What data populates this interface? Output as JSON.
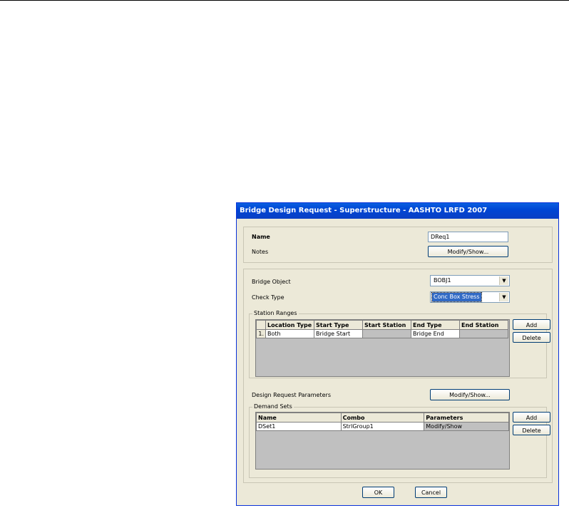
{
  "dialog": {
    "title": "Bridge Design Request - Superstructure - AASHTO LRFD 2007",
    "name_label": "Name",
    "name_value": "DReq1",
    "notes_label": "Notes",
    "notes_button": "Modify/Show...",
    "bridge_object_label": "Bridge Object",
    "bridge_object_value": "BOBJ1",
    "check_type_label": "Check Type",
    "check_type_value": "Conc Box Stress",
    "station_ranges": {
      "legend": "Station Ranges",
      "columns": [
        "Location Type",
        "Start Type",
        "Start Station",
        "End Type",
        "End Station"
      ],
      "rows": [
        {
          "num": "1.",
          "location_type": "Both",
          "start_type": "Bridge Start",
          "start_station": "",
          "end_type": "Bridge End",
          "end_station": ""
        }
      ],
      "add_button": "Add",
      "delete_button": "Delete"
    },
    "design_request_parameters_label": "Design Request Parameters",
    "design_request_parameters_button": "Modify/Show...",
    "demand_sets": {
      "legend": "Demand Sets",
      "columns": [
        "Name",
        "Combo",
        "Parameters"
      ],
      "rows": [
        {
          "name": "DSet1",
          "combo": "StrlGroup1",
          "parameters": "Modify/Show"
        }
      ],
      "add_button": "Add",
      "delete_button": "Delete"
    },
    "ok_button": "OK",
    "cancel_button": "Cancel"
  }
}
